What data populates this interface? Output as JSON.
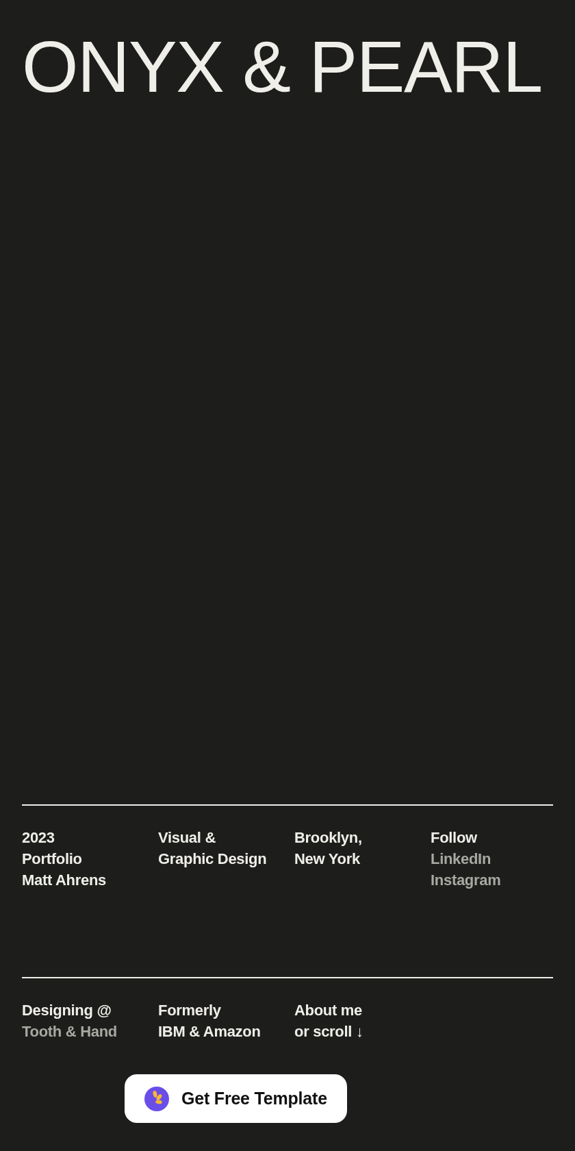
{
  "header": {
    "title": "ONYX & PEARL"
  },
  "info_rows": [
    {
      "columns": [
        {
          "lines": [
            {
              "kind": "text",
              "text": "2023"
            },
            {
              "kind": "text",
              "text": "Portfolio"
            },
            {
              "kind": "text",
              "text": "Matt Ahrens"
            }
          ]
        },
        {
          "lines": [
            {
              "kind": "text",
              "text": "Visual &"
            },
            {
              "kind": "text",
              "text": "Graphic Design"
            }
          ]
        },
        {
          "lines": [
            {
              "kind": "text",
              "text": "Brooklyn,"
            },
            {
              "kind": "text",
              "text": "New York"
            }
          ]
        },
        {
          "lines": [
            {
              "kind": "text",
              "text": "Follow"
            },
            {
              "kind": "link",
              "text": "LinkedIn"
            },
            {
              "kind": "link",
              "text": "Instagram"
            }
          ]
        }
      ]
    },
    {
      "columns": [
        {
          "lines": [
            {
              "kind": "text",
              "text": "Designing @"
            },
            {
              "kind": "link",
              "text": "Tooth & Hand"
            }
          ]
        },
        {
          "lines": [
            {
              "kind": "text",
              "text": "Formerly"
            },
            {
              "kind": "text",
              "text": "IBM & Amazon"
            }
          ]
        },
        {
          "lines": [
            {
              "kind": "text",
              "text": "About me"
            },
            {
              "kind": "text",
              "text": "or scroll ↓"
            }
          ]
        }
      ]
    }
  ],
  "template_button": {
    "label": "Get Free Template"
  }
}
